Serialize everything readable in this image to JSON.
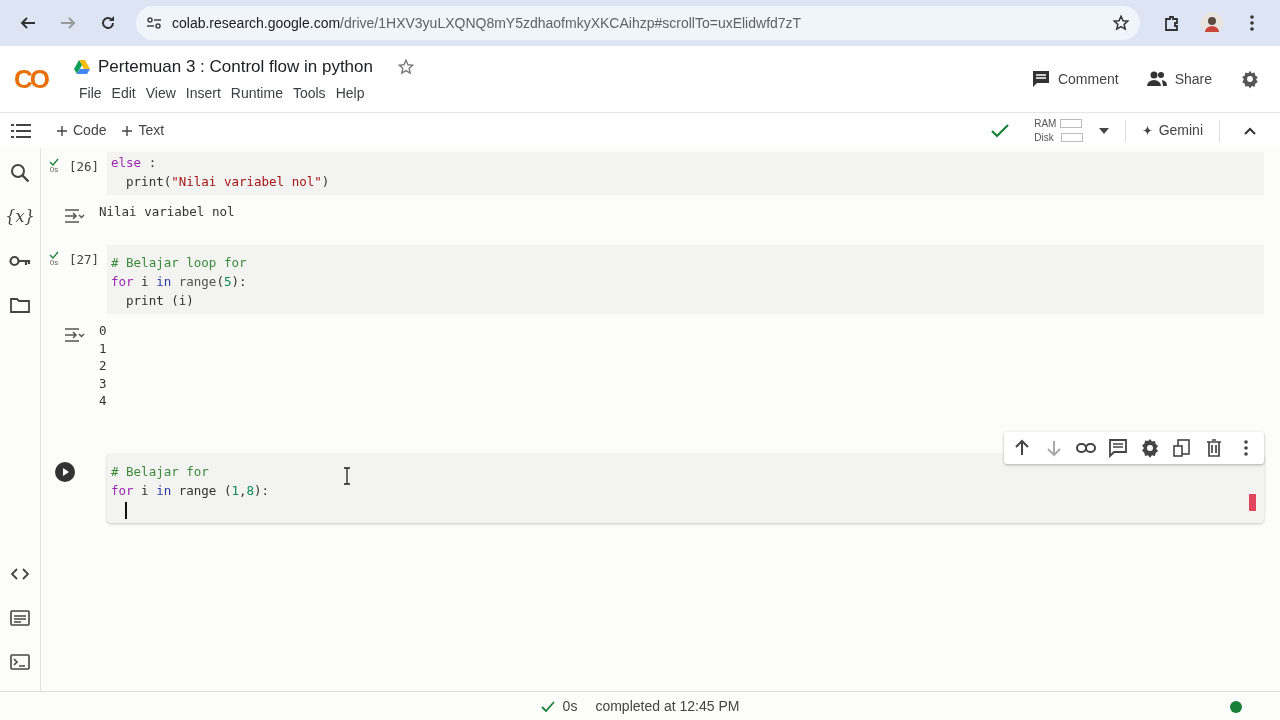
{
  "browser": {
    "url_host": "colab.research.google.com",
    "url_path": "/drive/1HXV3yuLXQNQ8mY5zdhaofmkyXKCAihzp#scrollTo=uxElidwfd7zT"
  },
  "header": {
    "logo": "CO",
    "title": "Pertemuan 3 : Control flow in python",
    "starred": false,
    "menu": [
      "File",
      "Edit",
      "View",
      "Insert",
      "Runtime",
      "Tools",
      "Help"
    ],
    "comment": "Comment",
    "share": "Share"
  },
  "toolbar": {
    "add_code": "Code",
    "add_text": "Text",
    "connected": true,
    "ram_label": "RAM",
    "disk_label": "Disk",
    "gemini": "Gemini"
  },
  "sidebar": {
    "variables": "{x}"
  },
  "cells": [
    {
      "kind": "code",
      "selected": false,
      "count": "[26]",
      "time": "0s",
      "lines": [
        [
          {
            "kind": "kw",
            "s": "else"
          },
          {
            "kind": "plain",
            "s": " :"
          }
        ],
        [
          {
            "kind": "plain",
            "s": "  print("
          },
          {
            "kind": "str",
            "s": "\"Nilai variabel nol\""
          },
          {
            "kind": "plain",
            "s": ")"
          }
        ]
      ],
      "output": [
        "Nilai variabel nol"
      ]
    },
    {
      "kind": "code",
      "selected": false,
      "count": "[27]",
      "time": "0s",
      "lines": [
        [
          {
            "kind": "comment",
            "s": "# Belajar loop for"
          }
        ],
        [
          {
            "kind": "kw",
            "s": "for"
          },
          {
            "kind": "plain",
            "s": " i "
          },
          {
            "kind": "kw2",
            "s": "in"
          },
          {
            "kind": "fn",
            "s": " range"
          },
          {
            "kind": "plain",
            "s": "("
          },
          {
            "kind": "num",
            "s": "5"
          },
          {
            "kind": "plain",
            "s": "):"
          }
        ],
        [
          {
            "kind": "plain",
            "s": "  print (i)"
          }
        ]
      ],
      "output": [
        "0",
        "1",
        "2",
        "3",
        "4"
      ]
    },
    {
      "kind": "code",
      "selected": true,
      "lines": [
        [
          {
            "kind": "comment",
            "s": "# Belajar for"
          }
        ],
        [
          {
            "kind": "kw",
            "s": "for"
          },
          {
            "kind": "plain",
            "s": " i "
          },
          {
            "kind": "kw2",
            "s": "in"
          },
          {
            "kind": "plain",
            "s": " range ("
          },
          {
            "kind": "num",
            "s": "1"
          },
          {
            "kind": "plain",
            "s": ","
          },
          {
            "kind": "num",
            "s": "8"
          },
          {
            "kind": "plain",
            "s": "):"
          }
        ]
      ]
    }
  ],
  "status_bar": {
    "time": "0s",
    "message": "completed at 12:45 PM",
    "connected": true
  }
}
